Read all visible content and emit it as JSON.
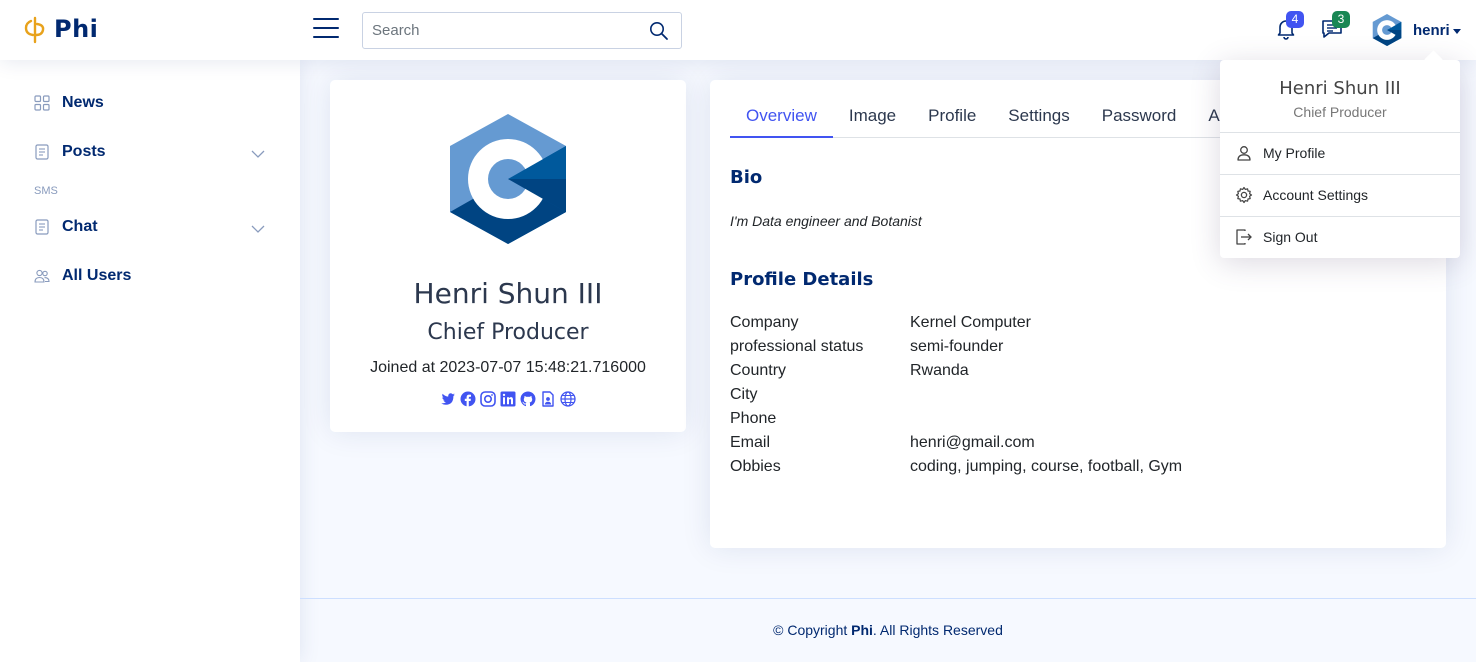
{
  "app": {
    "name": "Phi"
  },
  "search": {
    "placeholder": "Search"
  },
  "header": {
    "notifications_count": "4",
    "messages_count": "3",
    "username": "henri"
  },
  "sidebar": {
    "items": [
      {
        "label": "News"
      },
      {
        "label": "Posts"
      },
      {
        "label": "Chat"
      },
      {
        "label": "All Users"
      }
    ],
    "heading_sms": "SMS"
  },
  "profile": {
    "name": "Henri Shun III",
    "title": "Chief Producer",
    "joined": "Joined at 2023-07-07 15:48:21.716000",
    "socials": [
      "twitter-icon",
      "facebook-icon",
      "instagram-icon",
      "linkedin-icon",
      "github-icon",
      "contact-card-icon",
      "globe-icon"
    ]
  },
  "tabs": [
    {
      "label": "Overview"
    },
    {
      "label": "Image"
    },
    {
      "label": "Profile"
    },
    {
      "label": "Settings"
    },
    {
      "label": "Password"
    },
    {
      "label": "Ac"
    }
  ],
  "overview": {
    "bio_title": "Bio",
    "bio_text": "I'm Data engineer and Botanist",
    "details_title": "Profile Details",
    "details": [
      {
        "label": "Company",
        "value": "Kernel Computer"
      },
      {
        "label": "professional status",
        "value": "semi-founder"
      },
      {
        "label": "Country",
        "value": "Rwanda"
      },
      {
        "label": "City",
        "value": ""
      },
      {
        "label": "Phone",
        "value": ""
      },
      {
        "label": "Email",
        "value": "henri@gmail.com"
      },
      {
        "label": "Obbies",
        "value": "coding, jumping, course, football, Gym"
      }
    ]
  },
  "dropdown": {
    "name": "Henri Shun III",
    "role": "Chief Producer",
    "items": [
      {
        "label": "My Profile"
      },
      {
        "label": "Account Settings"
      },
      {
        "label": "Sign Out"
      }
    ]
  },
  "footer": {
    "prefix": "© Copyright ",
    "brand": "Phi",
    "suffix": ". All Rights Reserved"
  },
  "colors": {
    "primary": "#4154f1",
    "navy": "#012970",
    "badge_green": "#198754",
    "logo_gold": "#e8a21c",
    "page_bg": "#f6f9ff"
  }
}
